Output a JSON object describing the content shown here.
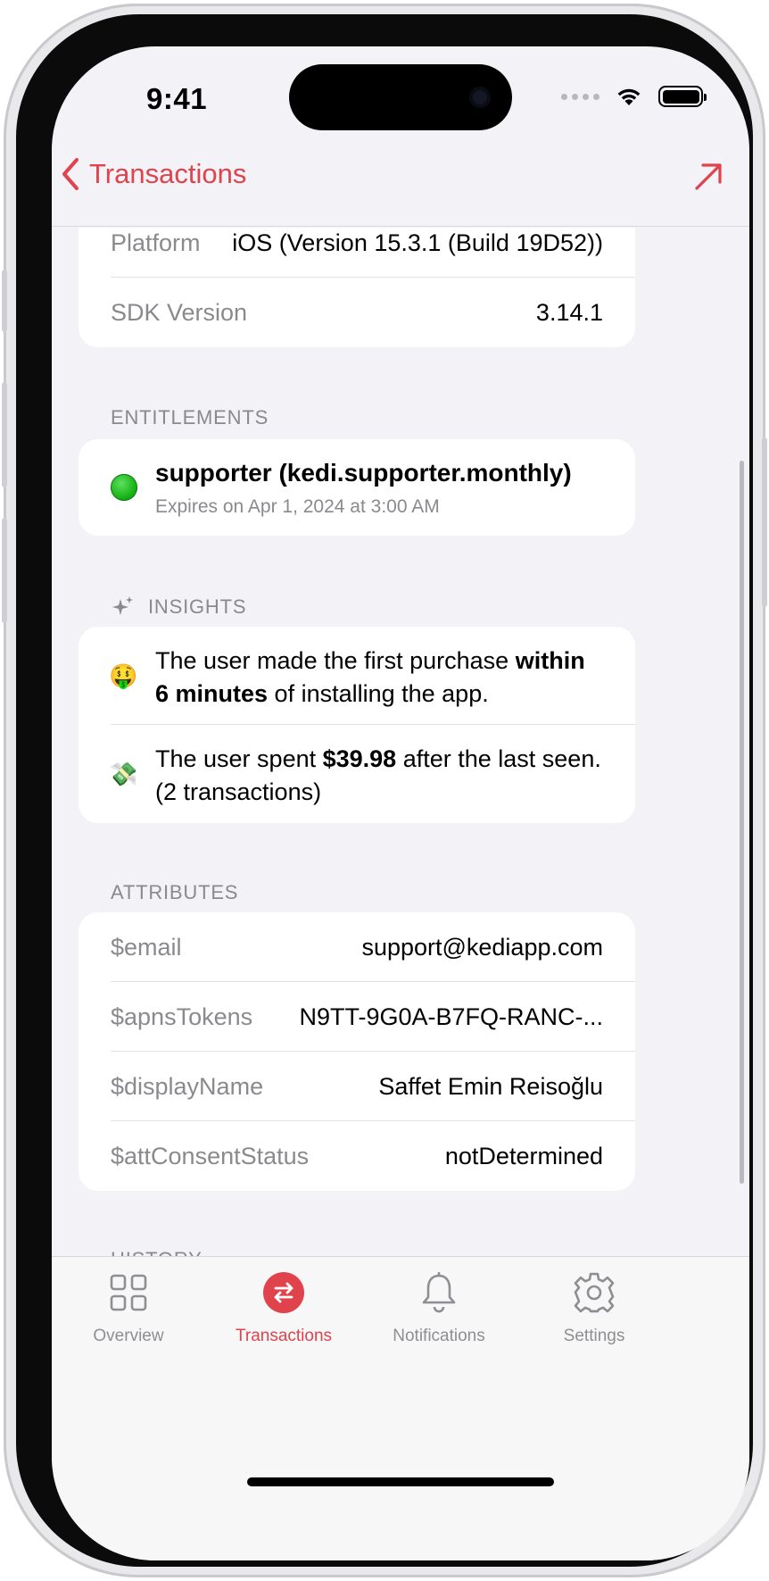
{
  "status_bar": {
    "time": "9:41"
  },
  "nav": {
    "back_label": "Transactions"
  },
  "device_info": [
    {
      "key": "Platform",
      "value": "iOS (Version 15.3.1 (Build 19D52))"
    },
    {
      "key": "SDK Version",
      "value": "3.14.1"
    }
  ],
  "entitlements": {
    "section_label": "ENTITLEMENTS",
    "item": {
      "title": "supporter (kedi.supporter.monthly)",
      "subtitle": "Expires on Apr 1, 2024 at 3:00 AM",
      "status_color": "#1fb51f"
    }
  },
  "insights": {
    "section_label": "INSIGHTS",
    "items": [
      {
        "emoji": "🤑",
        "text_before": "The user made the first purchase ",
        "bold": "within 6 minutes",
        "text_after": " of installing the app."
      },
      {
        "emoji": "💸",
        "text_before": "The user spent ",
        "bold": "$39.98",
        "text_after": " after the last seen. (2 transactions)"
      }
    ]
  },
  "attributes": {
    "section_label": "ATTRIBUTES",
    "rows": [
      {
        "key": "$email",
        "value": "support@kediapp.com"
      },
      {
        "key": "$apnsTokens",
        "value": "N9TT-9G0A-B7FQ-RANC-..."
      },
      {
        "key": "$displayName",
        "value": "Saffet Emin Reisoğlu"
      },
      {
        "key": "$attConsentStatus",
        "value": "notDetermined"
      }
    ]
  },
  "history": {
    "section_label": "HISTORY"
  },
  "tabs": [
    {
      "label": "Overview",
      "icon": "grid-icon",
      "active": false
    },
    {
      "label": "Transactions",
      "icon": "arrows-swap-icon",
      "active": true
    },
    {
      "label": "Notifications",
      "icon": "bell-icon",
      "active": false
    },
    {
      "label": "Settings",
      "icon": "gear-icon",
      "active": false
    }
  ],
  "colors": {
    "accent": "#e0434c",
    "secondary_text": "#8a8a8e",
    "background": "#f2f2f7"
  }
}
